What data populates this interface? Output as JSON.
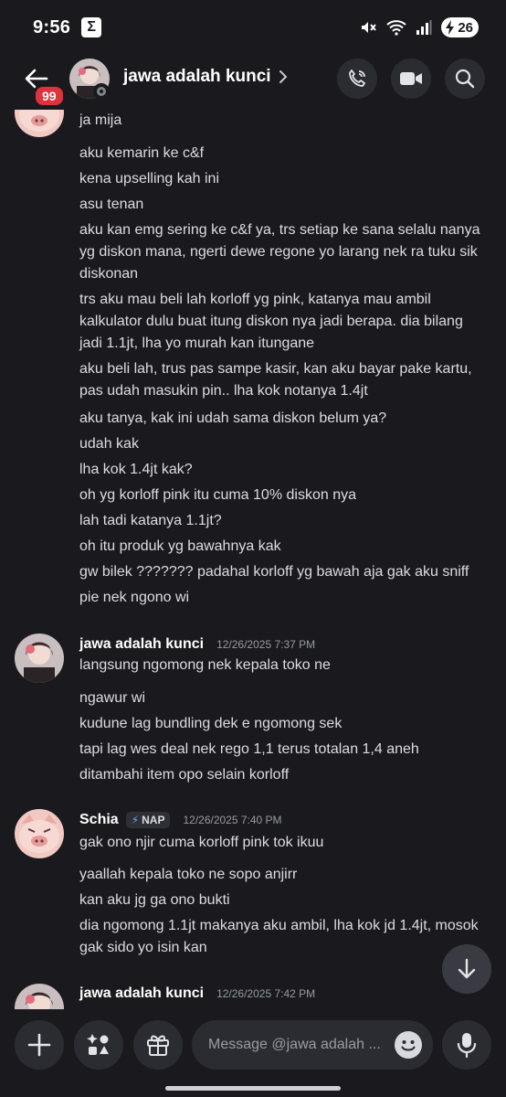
{
  "status_bar": {
    "time": "9:56",
    "app_icon_glyph": "Σ",
    "battery": "26"
  },
  "header": {
    "back_badge": "99",
    "title": "jawa adalah kunci",
    "icons": [
      "back-arrow-icon",
      "phone-call-icon",
      "video-camera-icon",
      "search-icon"
    ]
  },
  "messages": {
    "top_group_lines": [
      "ja mija",
      "aku kemarin ke c&f",
      "kena upselling kah ini",
      "asu tenan",
      "aku kan emg sering ke c&f ya, trs setiap ke sana selalu nanya yg diskon mana, ngerti dewe regone yo larang nek ra tuku sik diskonan",
      "trs aku mau beli lah korloff yg pink, katanya mau ambil kalkulator dulu buat itung diskon nya jadi berapa. dia bilang jadi 1.1jt, lha yo murah kan itungane",
      "aku beli lah, trus pas sampe kasir, kan aku bayar pake kartu, pas udah masukin pin.. lha kok notanya 1.4jt",
      "aku tanya, kak ini udah sama diskon belum ya?",
      "udah kak",
      "lha kok 1.4jt kak?",
      "oh yg korloff pink itu cuma 10% diskon nya",
      "lah tadi katanya 1.1jt?",
      "oh itu produk yg bawahnya kak",
      "gw bilek ??????? padahal korloff yg bawah aja gak aku sniff",
      "pie nek ngono wi"
    ],
    "group2": {
      "author": "jawa adalah kunci",
      "timestamp": "12/26/2025 7:37 PM",
      "lines": [
        "langsung ngomong nek kepala toko ne",
        "ngawur wi",
        "kudune lag bundling dek e ngomong sek",
        "tapi lag wes deal nek rego 1,1 terus totalan 1,4 aneh",
        "ditambahi item opo selain korloff"
      ]
    },
    "group3": {
      "author": "Schia",
      "tag": "NAP",
      "timestamp": "12/26/2025 7:40 PM",
      "lines": [
        "gak ono njir cuma korloff pink tok ikuu",
        "yaallah kepala toko ne sopo anjirr",
        "kan aku jg ga ono bukti",
        "dia ngomong 1.1jt makanya aku ambil, lha kok jd 1.4jt, mosok gak sido yo isin kan"
      ]
    },
    "group4": {
      "author": "jawa adalah kunci",
      "timestamp": "12/26/2025 7:42 PM"
    }
  },
  "composer": {
    "placeholder": "Message @jawa adalah ...",
    "icons": [
      "plus-icon",
      "apps-icon",
      "gift-icon",
      "emoji-icon",
      "microphone-icon"
    ]
  }
}
